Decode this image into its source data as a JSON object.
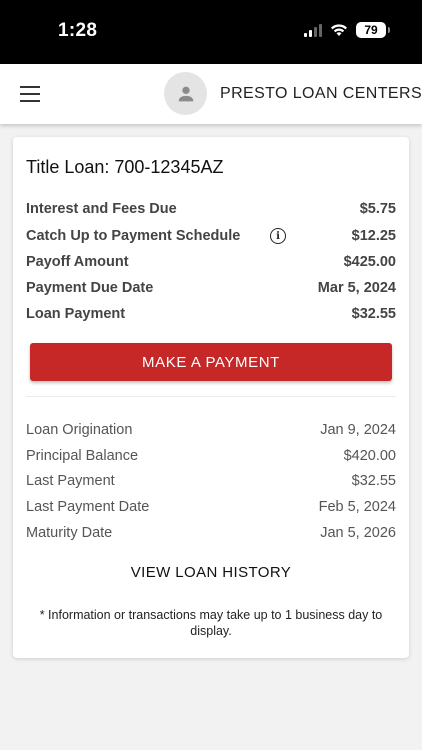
{
  "status_bar": {
    "time": "1:28",
    "battery": "79"
  },
  "header": {
    "title": "PRESTO LOAN CENTERS",
    "menu_icon": "hamburger-menu-icon",
    "avatar_icon": "person-icon"
  },
  "loan": {
    "title": "Title Loan: 700-12345AZ",
    "summary": [
      {
        "label": "Interest and Fees Due",
        "value": "$5.75"
      },
      {
        "label": "Catch Up to Payment Schedule",
        "value": "$12.25"
      },
      {
        "label": "Payoff Amount",
        "value": "$425.00"
      },
      {
        "label": "Payment Due Date",
        "value": "Mar 5, 2024"
      },
      {
        "label": "Loan Payment",
        "value": "$32.55"
      }
    ],
    "pay_button_label": "MAKE A PAYMENT",
    "details": [
      {
        "label": "Loan Origination",
        "value": "Jan 9, 2024"
      },
      {
        "label": "Principal Balance",
        "value": "$420.00"
      },
      {
        "label": "Last Payment",
        "value": "$32.55"
      },
      {
        "label": "Last Payment Date",
        "value": "Feb 5, 2024"
      },
      {
        "label": "Maturity Date",
        "value": "Jan 5, 2026"
      }
    ],
    "history_label": "VIEW LOAN HISTORY",
    "disclaimer": "* Information or transactions may take up to 1 business day to display."
  },
  "colors": {
    "accent": "#c62828",
    "background": "#f2f2f2"
  }
}
